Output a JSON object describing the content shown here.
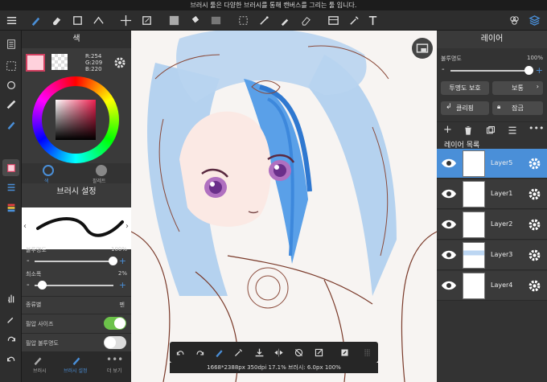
{
  "tip": "브러시 툴은 다양한 브러시를 통해 캔버스를 그리는 툴 입니다.",
  "color_panel": {
    "title": "색",
    "rgb": {
      "r": "R:254",
      "g": "G:209",
      "b": "B:220"
    },
    "tabs": [
      {
        "label": "색"
      },
      {
        "label": "팔레트"
      }
    ]
  },
  "brush_panel": {
    "title": "브러시 설정",
    "opacity_label": "불투명도",
    "opacity_value": "100%",
    "min_width_label": "최소폭",
    "min_width_value": "2%",
    "type_label": "종류별",
    "type_value": "펜",
    "pressure_size_label": "필압 사이즈",
    "pressure_opacity_label": "필압 불투명도",
    "tabs": [
      {
        "label": "브러시"
      },
      {
        "label": "브러시 설정"
      },
      {
        "label": "더 보기"
      }
    ]
  },
  "layer_panel": {
    "title": "레이어",
    "opacity_label": "불투명도",
    "opacity_value": "100%",
    "protect_label": "투명도 보호",
    "blend_label": "보통",
    "clip_label": "클리핑",
    "lock_label": "잠금",
    "list_title": "레이어 목록",
    "layers": [
      {
        "name": "Layer5",
        "selected": true
      },
      {
        "name": "Layer1",
        "selected": false
      },
      {
        "name": "Layer2",
        "selected": false
      },
      {
        "name": "Layer3",
        "selected": false
      },
      {
        "name": "Layer4",
        "selected": false
      }
    ]
  },
  "status": "1668*2388px 350dpi 17.1% 브러시: 6.0px 100%",
  "colors": {
    "accent": "#4a8fd8",
    "toggle_on": "#6cc24a",
    "fg_color": "#fed1dc"
  }
}
